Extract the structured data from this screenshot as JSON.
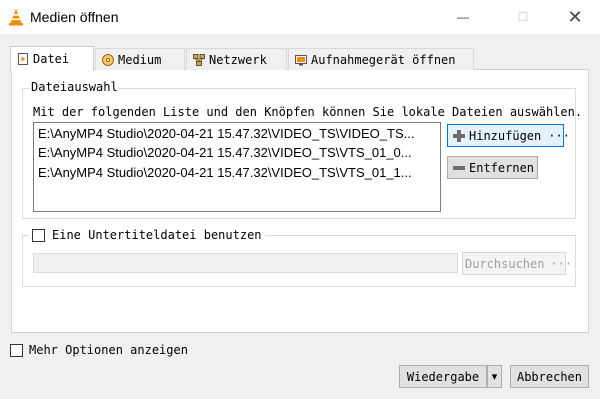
{
  "window": {
    "title": "Medien öffnen",
    "minimize_glyph": "—",
    "maximize_glyph": "☐",
    "close_glyph": "✕"
  },
  "tabs": [
    {
      "label": "Datei",
      "icon": "file-icon",
      "active": true
    },
    {
      "label": "Medium",
      "icon": "disc-icon",
      "active": false
    },
    {
      "label": "Netzwerk",
      "icon": "network-icon",
      "active": false
    },
    {
      "label": "Aufnahmegerät öffnen",
      "icon": "capture-device-icon",
      "active": false
    }
  ],
  "file_selection": {
    "group_title": "Dateiauswahl",
    "description": "Mit der folgenden Liste und den Knöpfen können Sie lokale Dateien auswählen.",
    "files": [
      "E:\\AnyMP4 Studio\\2020-04-21 15.47.32\\VIDEO_TS\\VIDEO_TS...",
      "E:\\AnyMP4 Studio\\2020-04-21 15.47.32\\VIDEO_TS\\VTS_01_0...",
      "E:\\AnyMP4 Studio\\2020-04-21 15.47.32\\VIDEO_TS\\VTS_01_1..."
    ],
    "add_button": "Hinzufügen",
    "add_button_ellipsis": "···",
    "remove_button": "Entfernen"
  },
  "subtitle": {
    "checkbox_label": "Eine Untertiteldatei benutzen",
    "checked": false,
    "path_value": "",
    "browse_button": "Durchsuchen",
    "browse_ellipsis": "···"
  },
  "footer": {
    "more_options_label": "Mehr Optionen anzeigen",
    "more_options_checked": false,
    "play_button": "Wiedergabe",
    "play_dropdown_glyph": "▾",
    "cancel_button": "Abbrechen"
  },
  "colors": {
    "accent": "#0078d7",
    "vlc_orange": "#f48b00"
  }
}
